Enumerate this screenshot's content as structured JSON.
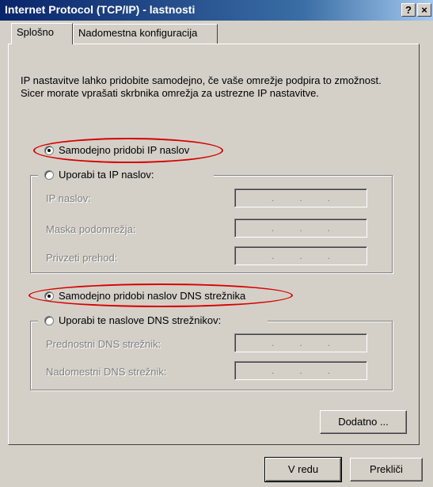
{
  "window": {
    "title": "Internet Protocol (TCP/IP) - lastnosti",
    "help_label": "?",
    "close_label": "×"
  },
  "tabs": [
    {
      "label": "Splošno"
    },
    {
      "label": "Nadomestna konfiguracija"
    }
  ],
  "description": "IP nastavitve lahko pridobite samodejno, če vaše omrežje podpira to zmožnost. Sicer morate vprašati skrbnika omrežja za ustrezne IP nastavitve.",
  "ip": {
    "auto_label": "Samodejno pridobi IP naslov",
    "manual_label": "Uporabi ta IP naslov:",
    "fields": [
      {
        "label": "IP naslov:"
      },
      {
        "label": "Maska podomrežja:"
      },
      {
        "label": "Privzeti prehod:"
      }
    ]
  },
  "dns": {
    "auto_label": "Samodejno pridobi naslov DNS strežnika",
    "manual_label": "Uporabi te naslove DNS strežnikov:",
    "fields": [
      {
        "label": "Prednostni DNS strežnik:"
      },
      {
        "label": "Nadomestni DNS strežnik:"
      }
    ]
  },
  "buttons": {
    "advanced": "Dodatno ...",
    "ok": "V redu",
    "cancel": "Prekliči"
  },
  "colors": {
    "accent": "#0a246a",
    "highlight_ellipse": "#d60000",
    "dialog_bg": "#d4d0c8"
  }
}
